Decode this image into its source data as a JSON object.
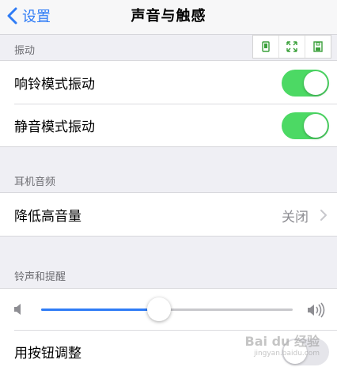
{
  "navbar": {
    "back_label": "设置",
    "title": "声音与触感"
  },
  "sections": {
    "vibration": {
      "header": "振动",
      "rows": [
        {
          "label": "响铃模式振动",
          "toggle_on": true
        },
        {
          "label": "静音模式振动",
          "toggle_on": true
        }
      ]
    },
    "headphone": {
      "header": "耳机音频",
      "rows": [
        {
          "label": "降低高音量",
          "value": "关闭"
        }
      ]
    },
    "ringer": {
      "header": "铃声和提醒",
      "volume_level": 0.47,
      "rows": [
        {
          "label": "用按钮调整",
          "toggle_on": false
        }
      ]
    }
  },
  "colors": {
    "accent": "#2f7cf6",
    "toggle_on": "#4cd964",
    "background": "#efeff4"
  },
  "icons": {
    "back": "chevron-left-icon",
    "disclosure": "chevron-right-icon",
    "volume_low": "speaker-low-icon",
    "volume_high": "speaker-high-icon",
    "toolbar": [
      "phone-frame-icon",
      "expand-icon",
      "save-icon"
    ]
  },
  "watermark": {
    "text": "Bai du 经验",
    "sub": "jingyan.baidu.com"
  }
}
